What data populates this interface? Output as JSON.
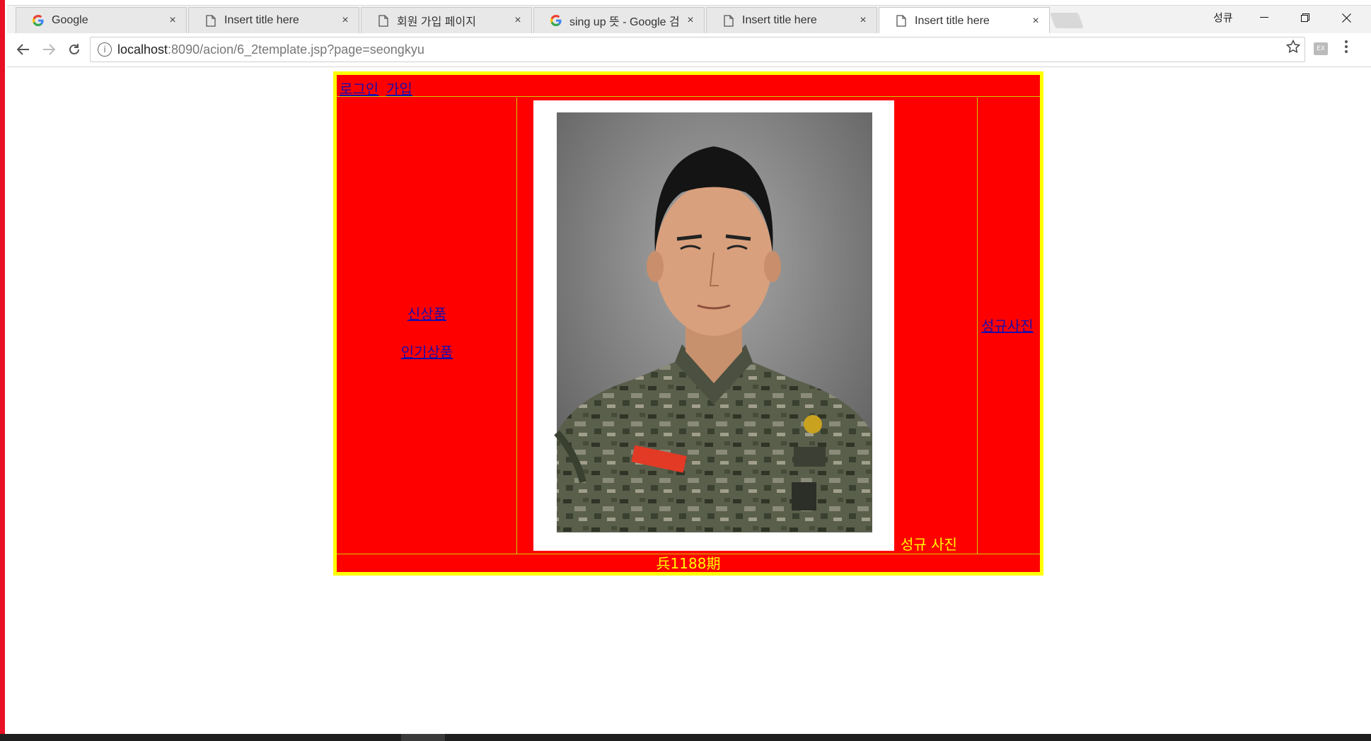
{
  "browser": {
    "tabs": [
      {
        "title": "Google",
        "icon": "google-g-icon"
      },
      {
        "title": "Insert title here",
        "icon": "page-icon"
      },
      {
        "title": "회원 가입 페이지",
        "icon": "page-icon"
      },
      {
        "title": "sing up 뜻 - Google 검",
        "icon": "google-g-icon"
      },
      {
        "title": "Insert title here",
        "icon": "page-icon"
      },
      {
        "title": "Insert title here",
        "icon": "page-icon",
        "active": true
      }
    ],
    "close_glyph": "×",
    "profile_name": "성큐",
    "address": {
      "host": "localhost",
      "path": ":8090/acion/6_2template.jsp?page=seongkyu"
    },
    "extension_label": "EX"
  },
  "page": {
    "top_links": {
      "login": "로그인",
      "join": "가입"
    },
    "left_menu": {
      "new_products": "신상품",
      "popular_products": "인기상품"
    },
    "right_link": "성규사진",
    "photo_caption": "성규 사진",
    "footer": "兵1188期",
    "colors": {
      "background": "#ff0000",
      "border": "#ffff00",
      "link": "#1a0dab"
    }
  }
}
